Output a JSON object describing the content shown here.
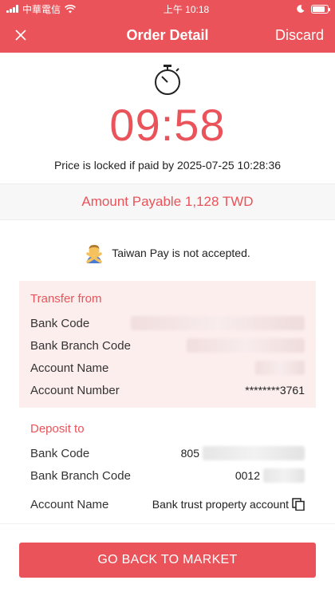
{
  "status_bar": {
    "carrier": "中華電信",
    "time": "上午 10:18"
  },
  "nav": {
    "title": "Order Detail",
    "discard_label": "Discard",
    "close_icon": "close-icon"
  },
  "timer": {
    "countdown": "09:58",
    "locked_text": "Price is locked if paid by 2025-07-25 10:28:36"
  },
  "amount": {
    "label": "Amount Payable 1,128 TWD"
  },
  "notice": {
    "text": "Taiwan Pay is not accepted."
  },
  "transfer_from": {
    "title": "Transfer from",
    "rows": [
      {
        "label": "Bank Code",
        "value": ""
      },
      {
        "label": "Bank Branch Code",
        "value": ""
      },
      {
        "label": "Account Name",
        "value": ""
      },
      {
        "label": "Account Number",
        "value": "********3761"
      }
    ]
  },
  "deposit_to": {
    "title": "Deposit to",
    "rows": [
      {
        "label": "Bank Code",
        "value": "805"
      },
      {
        "label": "Bank Branch Code",
        "value": "0012"
      },
      {
        "label": "Account Name",
        "value": "Bank trust property account"
      }
    ]
  },
  "footer": {
    "button_label": "GO BACK TO MARKET"
  },
  "colors": {
    "accent": "#e95359",
    "card_bg": "#fdeeee"
  }
}
